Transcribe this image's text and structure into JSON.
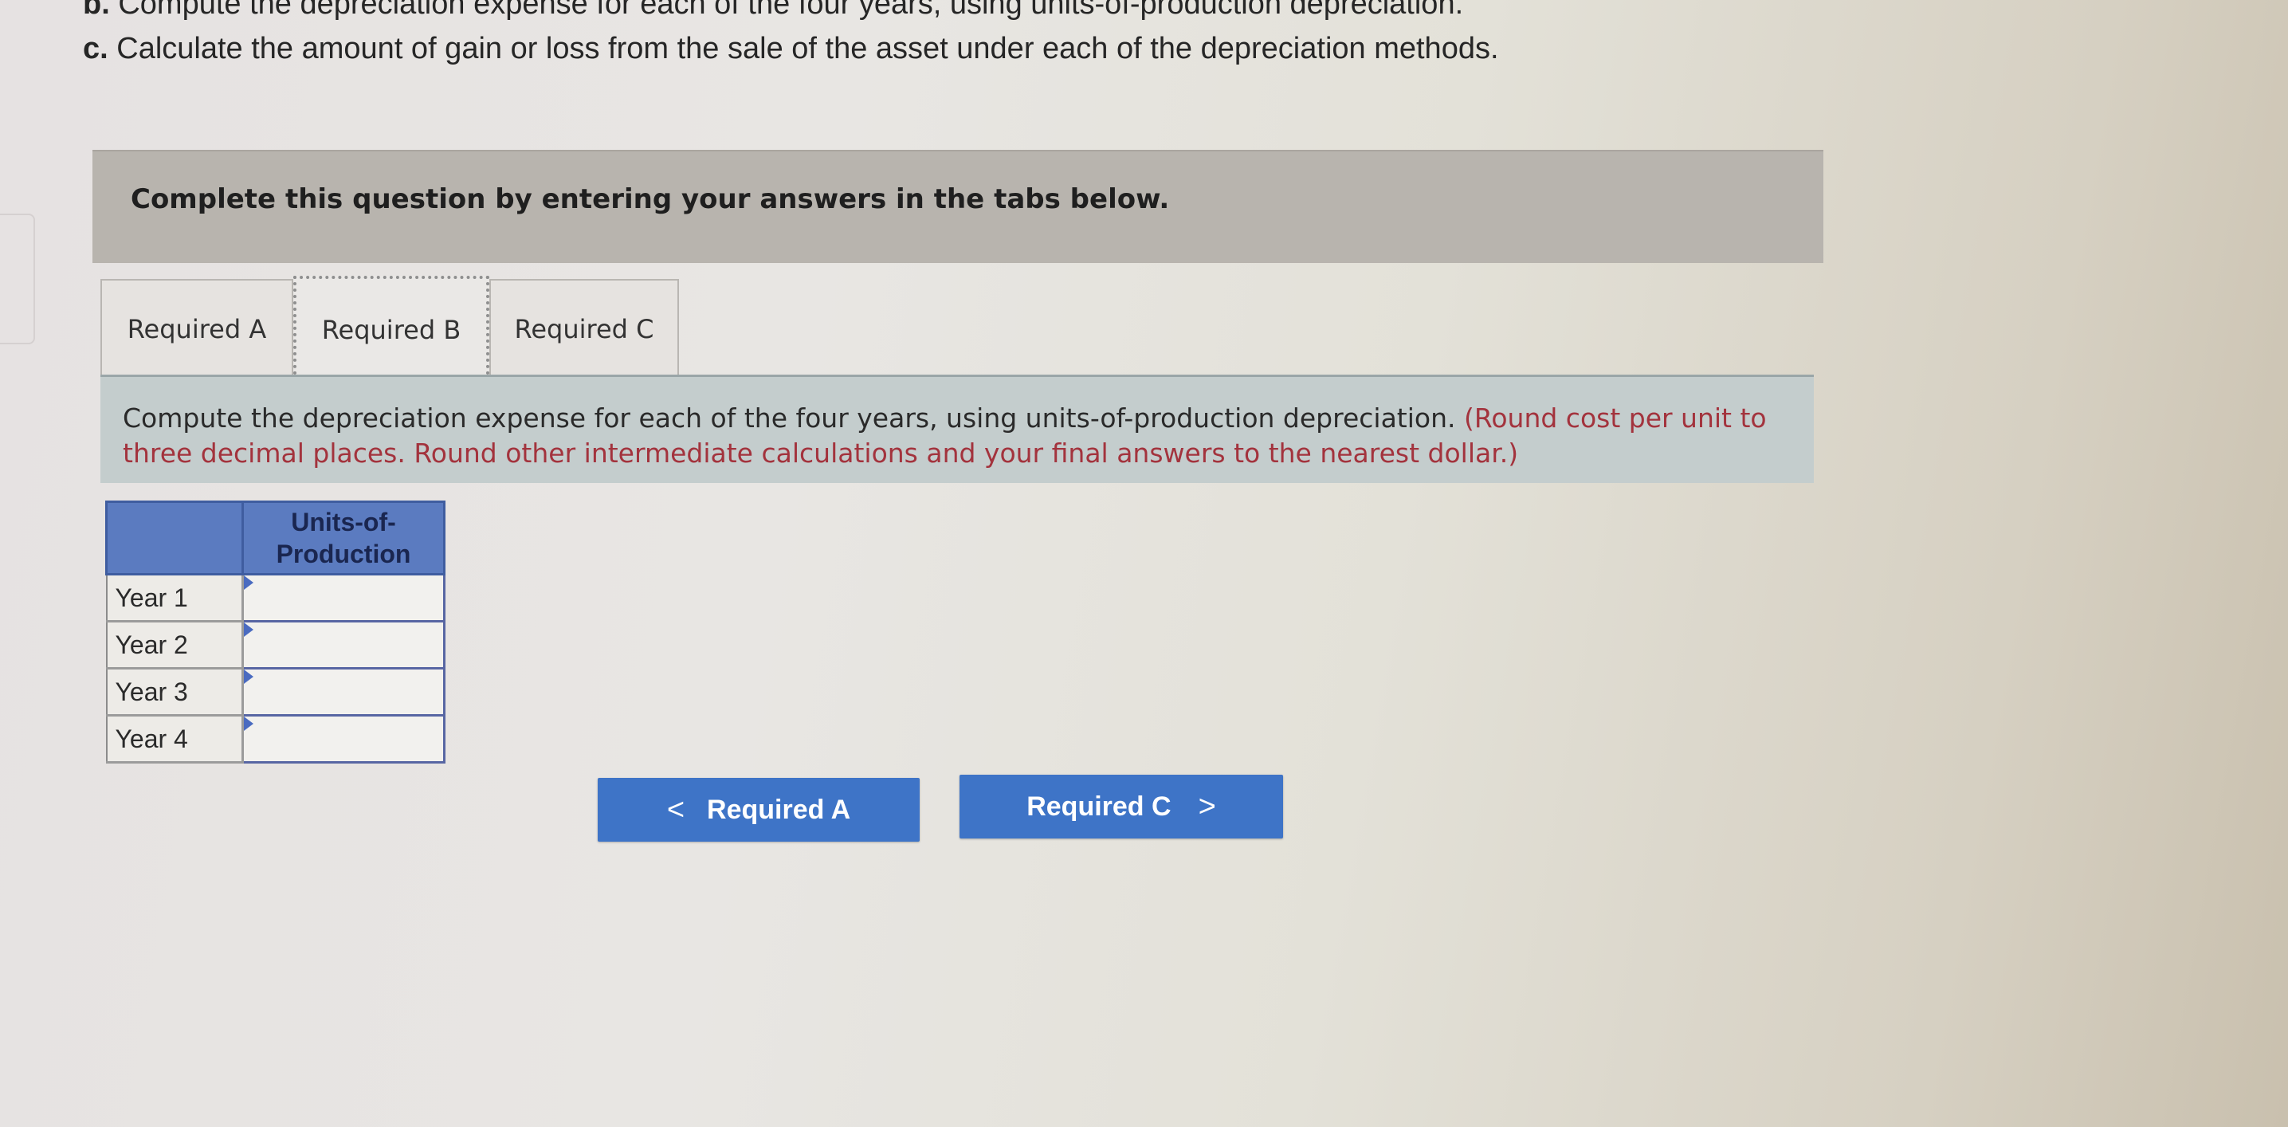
{
  "instructions": {
    "b_letter": "b.",
    "b_text": "Compute the depreciation expense for each of the four years, using units-of-production depreciation.",
    "c_letter": "c.",
    "c_text": "Calculate the amount of gain or loss from the sale of the asset under each of the depreciation methods."
  },
  "banner": {
    "text": "Complete this question by entering your answers in the tabs below."
  },
  "tabs": [
    {
      "label": "Required A"
    },
    {
      "label": "Required B"
    },
    {
      "label": "Required C"
    }
  ],
  "active_tab": "Required B",
  "panel": {
    "text": "Compute the depreciation expense for each of the four years, using units-of-production depreciation.",
    "note": "(Round cost per unit to three decimal places. Round other intermediate calculations and your final answers to the nearest dollar.)"
  },
  "table": {
    "column_header_line1": "Units-of-",
    "column_header_line2": "Production",
    "rows": [
      {
        "label": "Year 1",
        "value": ""
      },
      {
        "label": "Year 2",
        "value": ""
      },
      {
        "label": "Year 3",
        "value": ""
      },
      {
        "label": "Year 4",
        "value": ""
      }
    ]
  },
  "nav": {
    "prev_label": "Required A",
    "next_label": "Required C",
    "prev_chevron": "<",
    "next_chevron": ">"
  },
  "colors": {
    "button": "#3e74c7",
    "table_header": "#5b7bc0",
    "note": "#a3333d",
    "panel": "#c4cdcd"
  }
}
